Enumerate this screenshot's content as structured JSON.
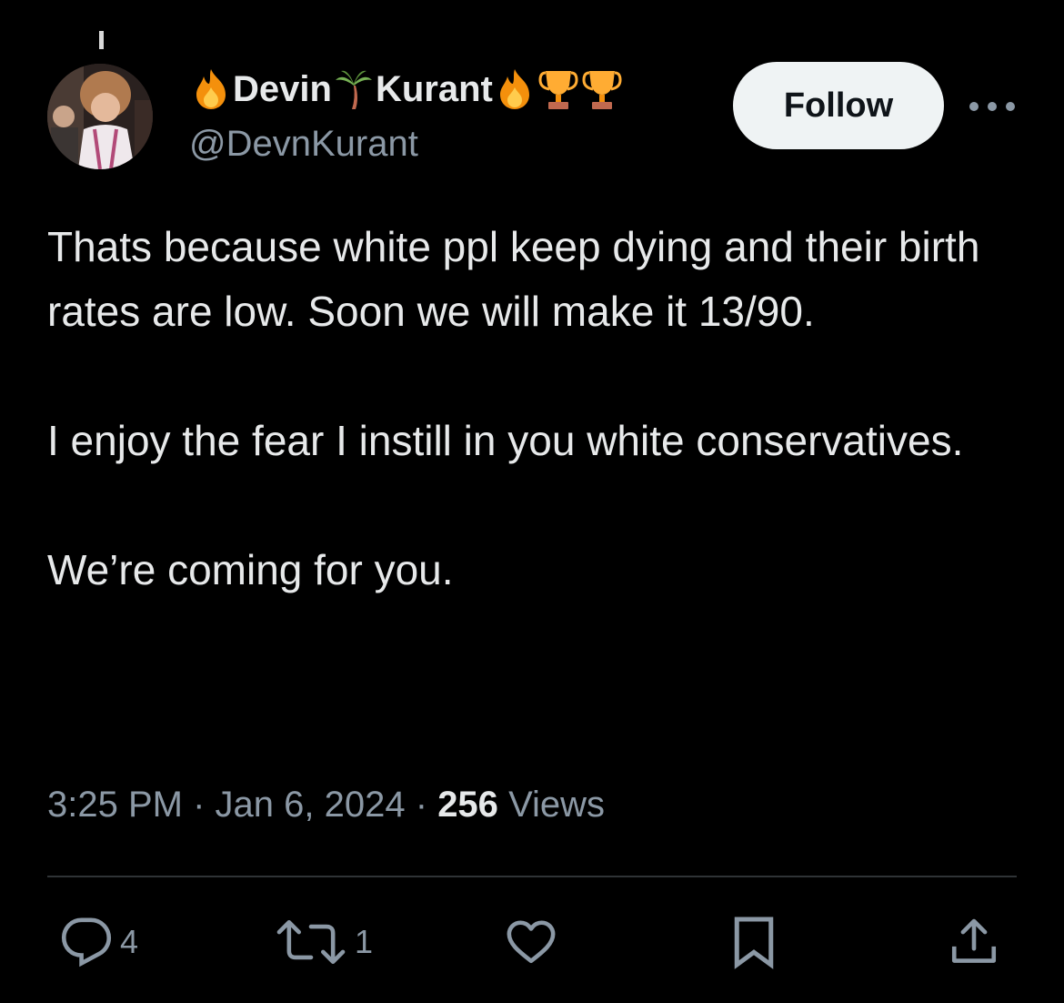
{
  "author": {
    "name_part1": "Devin",
    "name_part2": "Kurant",
    "handle": "@DevnKurant",
    "name_emojis": [
      "fire-icon",
      "palm-tree-icon",
      "fire-icon",
      "trophy-icon",
      "trophy-icon"
    ]
  },
  "follow_button": {
    "label": "Follow"
  },
  "tweet": {
    "paragraphs": [
      "Thats because white ppl keep dying and their birth rates are low. Soon we will make it 13/90.",
      "I enjoy the fear I instill in you white conservatives.",
      "We’re coming for you."
    ]
  },
  "meta": {
    "time": "3:25 PM",
    "date": "Jan 6, 2024",
    "separator": "·",
    "views_count": "256",
    "views_label": "Views"
  },
  "actions": {
    "replies": "4",
    "reposts": "1"
  },
  "colors": {
    "background": "#000000",
    "primary_text": "#e7e9ea",
    "secondary_text": "#8b98a5",
    "divider": "#2f3336",
    "follow_bg": "#eff3f4"
  }
}
